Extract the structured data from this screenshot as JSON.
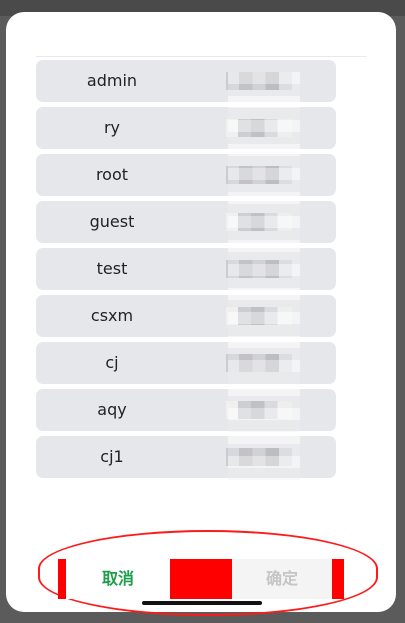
{
  "users": [
    {
      "name": "admin"
    },
    {
      "name": "ry"
    },
    {
      "name": "root"
    },
    {
      "name": "guest"
    },
    {
      "name": "test"
    },
    {
      "name": "csxm"
    },
    {
      "name": "cj"
    },
    {
      "name": "aqy"
    },
    {
      "name": "cj1"
    }
  ],
  "footer": {
    "cancel_label": "取消",
    "confirm_label": "确定"
  },
  "colors": {
    "accent": "#1e9e4a",
    "annotation": "#ff0000"
  }
}
